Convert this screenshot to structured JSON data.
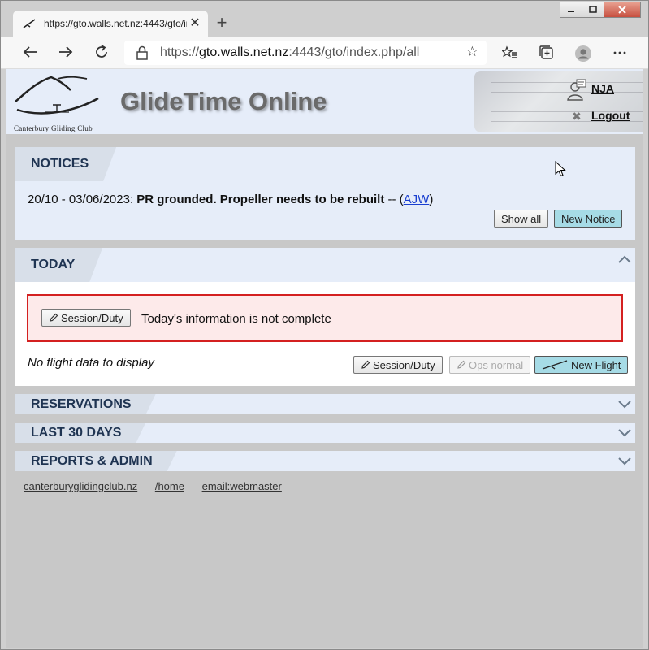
{
  "browser": {
    "tab_title": "https://gto.walls.net.nz:4443/gto/index.php/all",
    "url_prefix": "https://",
    "url_host": "gto.walls.net.nz",
    "url_path": ":4443/gto/index.php/all",
    "new_tab_glyph": "+",
    "close_glyph": "✕"
  },
  "header": {
    "site_title": "GlideTime Online",
    "logo_text": "Canterbury Gliding Club",
    "user": "NJA",
    "logout": "Logout"
  },
  "notices": {
    "title": "NOTICES",
    "date_range": "20/10 - 03/06/2023:",
    "message": "PR grounded. Propeller needs to be rebuilt",
    "separator": " -- (",
    "author": "AJW",
    "closing": ")",
    "show_all": "Show all",
    "new_notice": "New Notice"
  },
  "today": {
    "title": "TODAY",
    "session_duty": "Session/Duty",
    "alert_text": "Today's information is not complete",
    "no_flight": "No flight data to display",
    "ops_normal": "Ops normal",
    "new_flight": "New Flight"
  },
  "sections": {
    "reservations": "RESERVATIONS",
    "last30": "LAST 30 DAYS",
    "reports": "REPORTS & ADMIN"
  },
  "footer": {
    "link1": "canterburyglidingclub.nz",
    "link2": "/home",
    "link3": " email:webmaster"
  }
}
